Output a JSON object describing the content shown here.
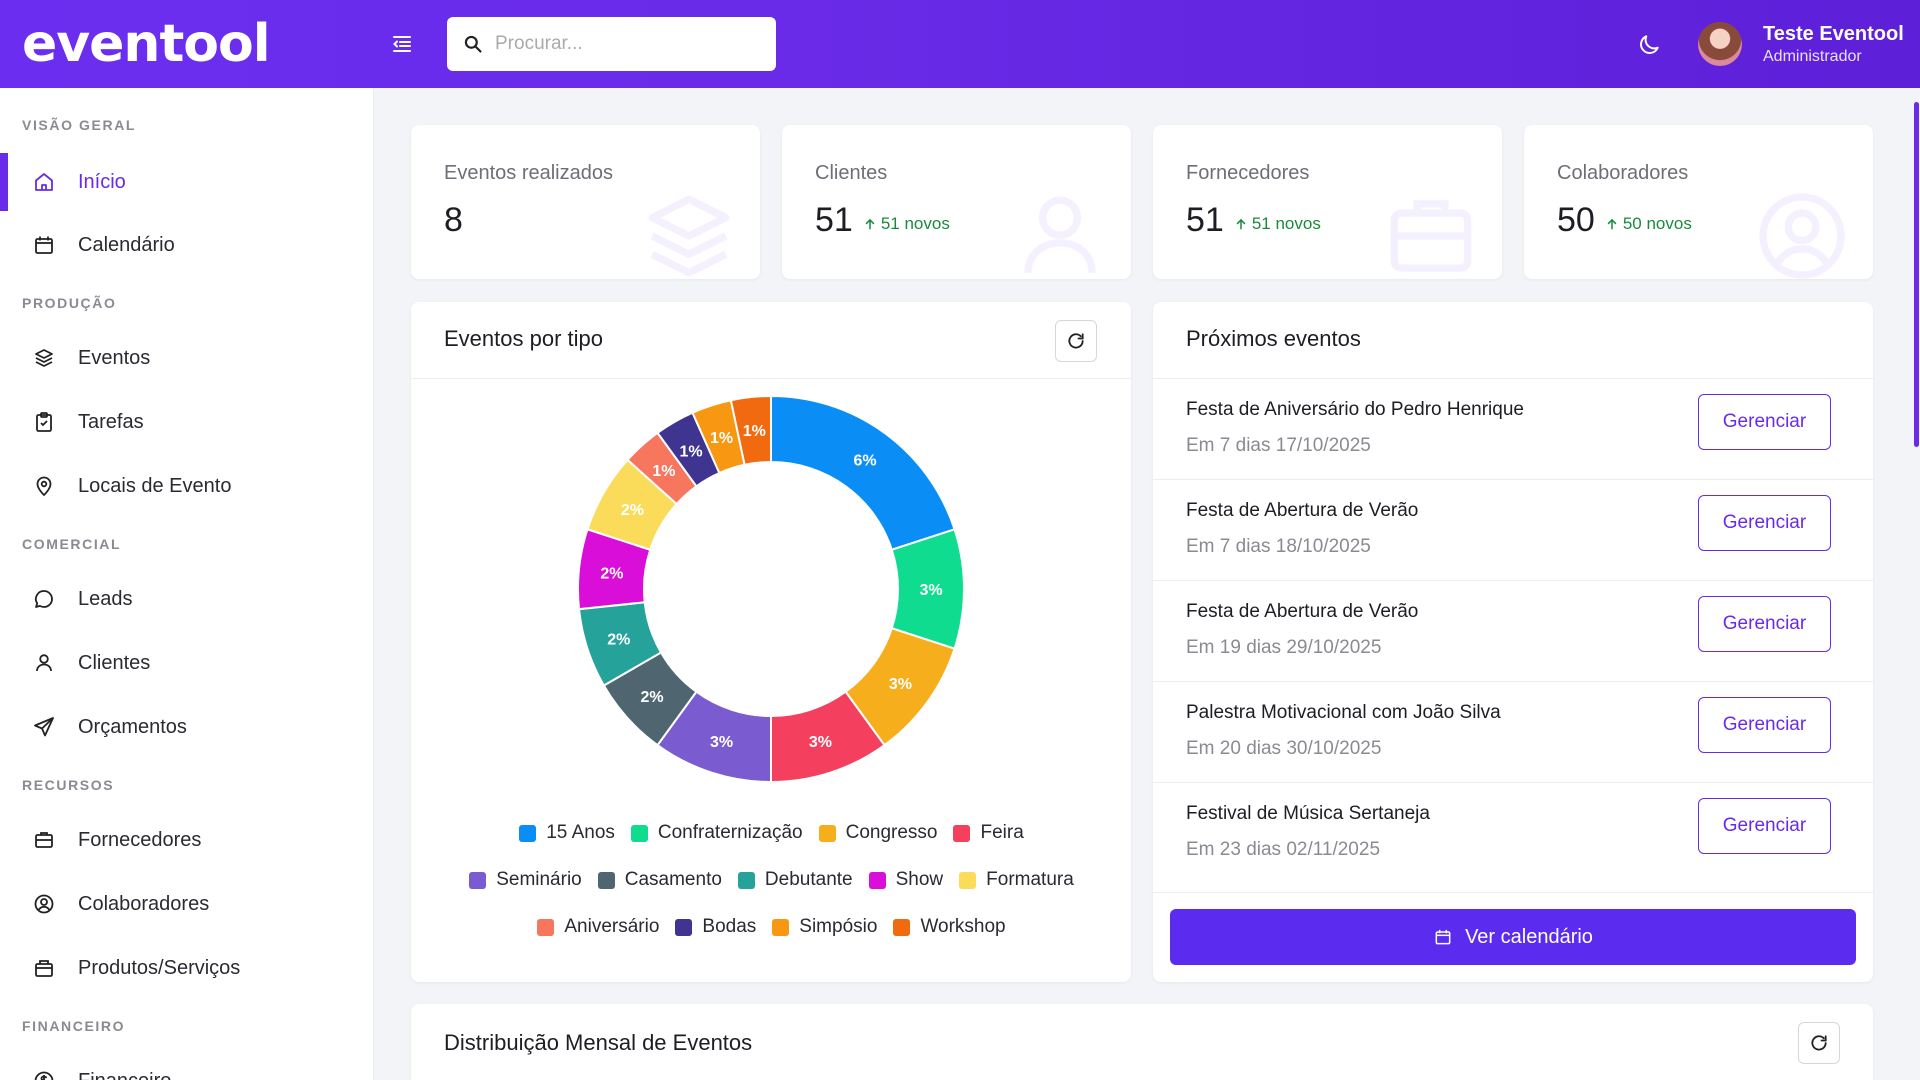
{
  "brand": "eventool",
  "search": {
    "placeholder": "Procurar..."
  },
  "user": {
    "name": "Teste Eventool",
    "role": "Administrador"
  },
  "sidebar": {
    "sections": [
      "VISÃO GERAL",
      "PRODUÇÃO",
      "COMERCIAL",
      "RECURSOS",
      "FINANCEIRO"
    ],
    "items": [
      {
        "label": "Início",
        "icon": "home-icon",
        "active": true
      },
      {
        "label": "Calendário",
        "icon": "calendar-icon"
      },
      {
        "label": "Eventos",
        "icon": "layers-icon"
      },
      {
        "label": "Tarefas",
        "icon": "clipboard-icon"
      },
      {
        "label": "Locais de Evento",
        "icon": "map-pin-icon"
      },
      {
        "label": "Leads",
        "icon": "chat-bubble-icon"
      },
      {
        "label": "Clientes",
        "icon": "user-icon"
      },
      {
        "label": "Orçamentos",
        "icon": "send-icon"
      },
      {
        "label": "Fornecedores",
        "icon": "briefcase-icon"
      },
      {
        "label": "Colaboradores",
        "icon": "user-circle-icon"
      },
      {
        "label": "Produtos/Serviços",
        "icon": "box-icon"
      },
      {
        "label": "Financeiro",
        "icon": "dollar-circle-icon"
      }
    ]
  },
  "stats": [
    {
      "label": "Eventos realizados",
      "value": "8",
      "new": "",
      "icon": "layers-icon"
    },
    {
      "label": "Clientes",
      "value": "51",
      "new": "51 novos",
      "icon": "user-icon"
    },
    {
      "label": "Fornecedores",
      "value": "51",
      "new": "51 novos",
      "icon": "briefcase-icon"
    },
    {
      "label": "Colaboradores",
      "value": "50",
      "new": "50 novos",
      "icon": "user-circle-icon"
    }
  ],
  "events_by_type": {
    "title": "Eventos por tipo"
  },
  "chart_data": {
    "type": "pie",
    "title": "Eventos por tipo",
    "categories": [
      "15 Anos",
      "Confraternização",
      "Congresso",
      "Feira",
      "Seminário",
      "Casamento",
      "Debutante",
      "Show",
      "Formatura",
      "Aniversário",
      "Bodas",
      "Simpósio",
      "Workshop"
    ],
    "labels": [
      "6%",
      "3%",
      "3%",
      "3%",
      "3%",
      "2%",
      "2%",
      "2%",
      "2%",
      "1%",
      "1%",
      "1%",
      "1%"
    ],
    "values": [
      6,
      3,
      3,
      3,
      3,
      2,
      2,
      2,
      2,
      1,
      1,
      1,
      1
    ],
    "colors": [
      "#0a8ef5",
      "#0fdc8f",
      "#f7ae1c",
      "#f43f5e",
      "#7b5bd0",
      "#4f6670",
      "#25a39a",
      "#d90fd9",
      "#fadc5a",
      "#f7765e",
      "#3f3490",
      "#f79712",
      "#f26a10"
    ],
    "legend": "bottom"
  },
  "upcoming": {
    "title": "Próximos eventos",
    "manage_label": "Gerenciar",
    "calendar_label": "Ver calendário",
    "items": [
      {
        "title": "Festa de Aniversário do Pedro Henrique",
        "date": "Em 7 dias 17/10/2025"
      },
      {
        "title": "Festa de Abertura de Verão",
        "date": "Em 7 dias 18/10/2025"
      },
      {
        "title": "Festa de Abertura de Verão",
        "date": "Em 19 dias 29/10/2025"
      },
      {
        "title": "Palestra Motivacional com João Silva",
        "date": "Em 20 dias 30/10/2025"
      },
      {
        "title": "Festival de Música Sertaneja",
        "date": "Em 23 dias 02/11/2025"
      }
    ]
  },
  "monthly": {
    "title": "Distribuição Mensal de Eventos"
  },
  "colors": {
    "primary": "#6a2be8",
    "button": "#5b2cf0",
    "positive": "#1b8a3c"
  }
}
